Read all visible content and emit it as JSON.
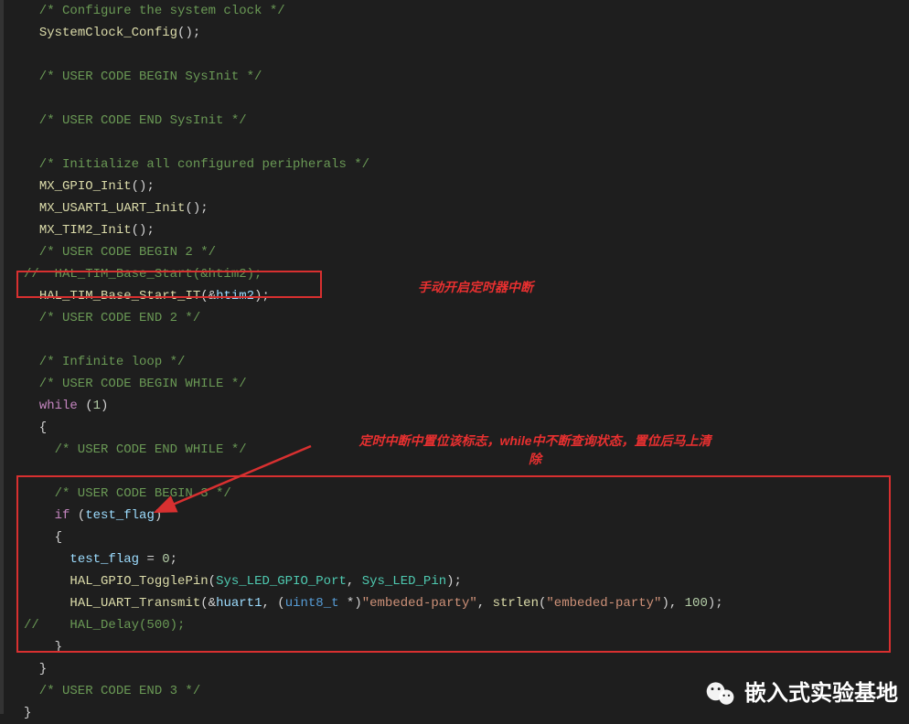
{
  "code": {
    "l01": "  /* Configure the system clock */",
    "l02": "  SystemClock_Config();",
    "l03": "",
    "l04": "  /* USER CODE BEGIN SysInit */",
    "l05": "",
    "l06": "  /* USER CODE END SysInit */",
    "l07": "",
    "l08": "  /* Initialize all configured peripherals */",
    "l09": "  MX_GPIO_Init();",
    "l10": "  MX_USART1_UART_Init();",
    "l11": "  MX_TIM2_Init();",
    "l12": "  /* USER CODE BEGIN 2 */",
    "l13": "//  HAL_TIM_Base_Start(&htim2);",
    "l14_pre": "  ",
    "l14_fn": "HAL_TIM_Base_Start_IT",
    "l14_arg": "htim2",
    "l15": "  /* USER CODE END 2 */",
    "l16": "",
    "l17": "  /* Infinite loop */",
    "l18": "  /* USER CODE BEGIN WHILE */",
    "l19_kw": "while",
    "l19_num": "1",
    "l20": "  {",
    "l21": "    /* USER CODE END WHILE */",
    "l22": "",
    "l23": "    /* USER CODE BEGIN 3 */",
    "l24_kw": "if",
    "l24_var": "test_flag",
    "l25": "    {",
    "l26_var": "test_flag",
    "l26_val": "0",
    "l27_fn": "HAL_GPIO_TogglePin",
    "l27_a1": "Sys_LED_GPIO_Port",
    "l27_a2": "Sys_LED_Pin",
    "l28_fn": "HAL_UART_Transmit",
    "l28_arg1": "huart1",
    "l28_cast": "uint8_t",
    "l28_str": "\"embeded-party\"",
    "l28_strlen": "strlen",
    "l28_str2": "\"embeded-party\"",
    "l28_num": "100",
    "l29": "//    HAL_Delay(500);",
    "l30": "    }",
    "l31": "  }",
    "l32": "  /* USER CODE END 3 */",
    "l33": "}"
  },
  "annotations": {
    "a1": "手动开启定时器中断",
    "a2_line1": "定时中断中置位该标志，while中不断查询状态，置位后马上清",
    "a2_line2": "除"
  },
  "watermark": "嵌入式实验基地"
}
